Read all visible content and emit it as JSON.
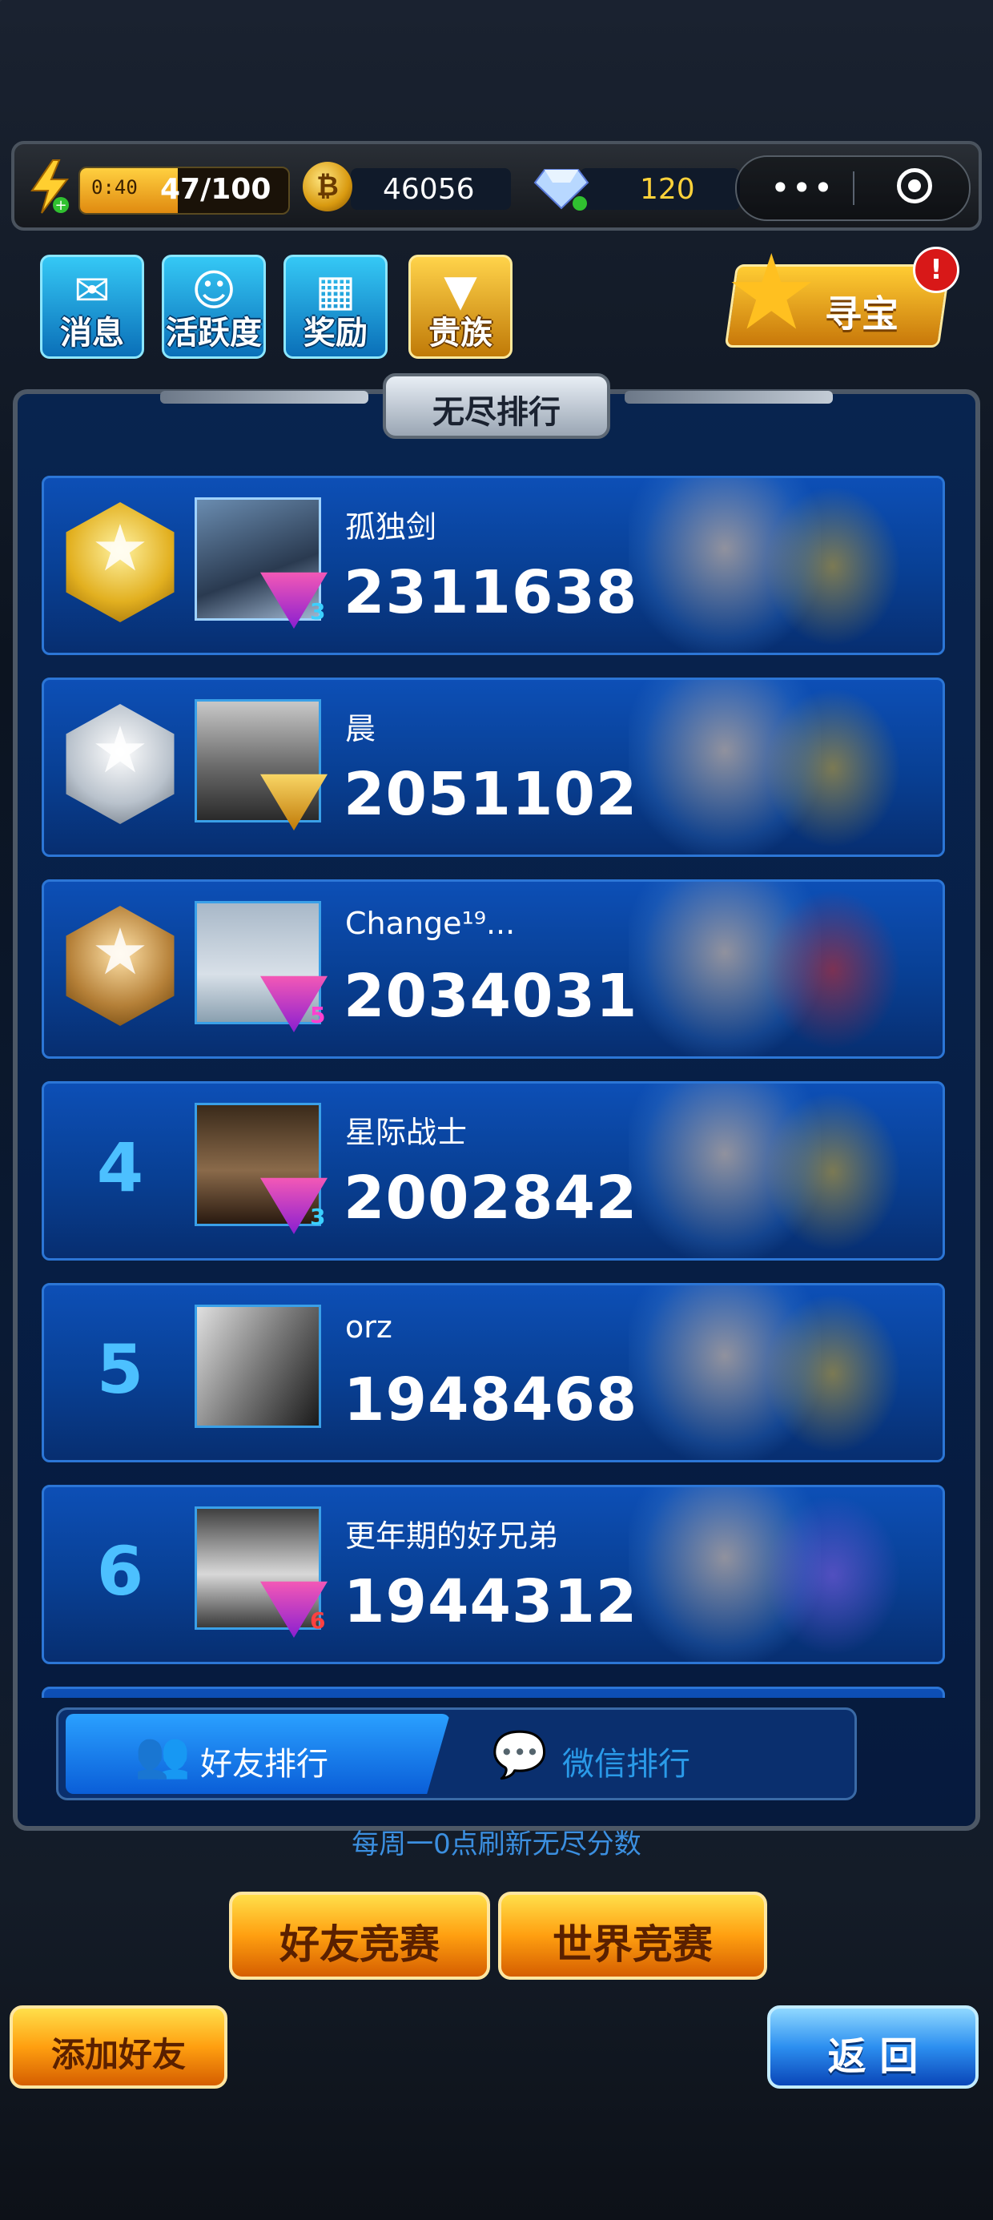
{
  "topbar": {
    "energy_timer": "0:40",
    "energy_count": "47/100",
    "energy_fraction": 0.47,
    "coins": "46056",
    "coin_symbol": "₿",
    "gems": "120",
    "more_icon": "•••",
    "target_icon": "target-icon"
  },
  "menu": {
    "messages": "消息",
    "activity": "活跃度",
    "rewards": "奖励",
    "nobility": "贵族",
    "treasure": "寻宝",
    "treasure_badge": "!"
  },
  "panel": {
    "title": "无尽排行"
  },
  "ranking": [
    {
      "rank": "1",
      "medal": "gold",
      "name": "孤独剑",
      "score": "2311638",
      "vip_level": "3"
    },
    {
      "rank": "2",
      "medal": "silver",
      "name": "晨",
      "score": "2051102",
      "vip_level": ""
    },
    {
      "rank": "3",
      "medal": "bronze",
      "name": "Change¹⁹...",
      "score": "2034031",
      "vip_level": "5"
    },
    {
      "rank": "4",
      "medal": "",
      "name": "星际战士",
      "score": "2002842",
      "vip_level": "3"
    },
    {
      "rank": "5",
      "medal": "",
      "name": "orz",
      "score": "1948468",
      "vip_level": ""
    },
    {
      "rank": "6",
      "medal": "",
      "name": "更年期的好兄弟",
      "score": "1944312",
      "vip_level": "6"
    }
  ],
  "tabs": {
    "friends": "好友排行",
    "wechat": "微信排行"
  },
  "refresh_note": "每周一0点刷新无尽分数",
  "buttons": {
    "friend_match": "好友竞赛",
    "world_match": "世界竞赛",
    "add_friend": "添加好友",
    "back": "返 回"
  },
  "colors": {
    "accent_blue": "#0a5ed8",
    "rank_number": "#4cc0ff",
    "gem_value": "#ffd23a",
    "badge_red": "#d81818"
  }
}
